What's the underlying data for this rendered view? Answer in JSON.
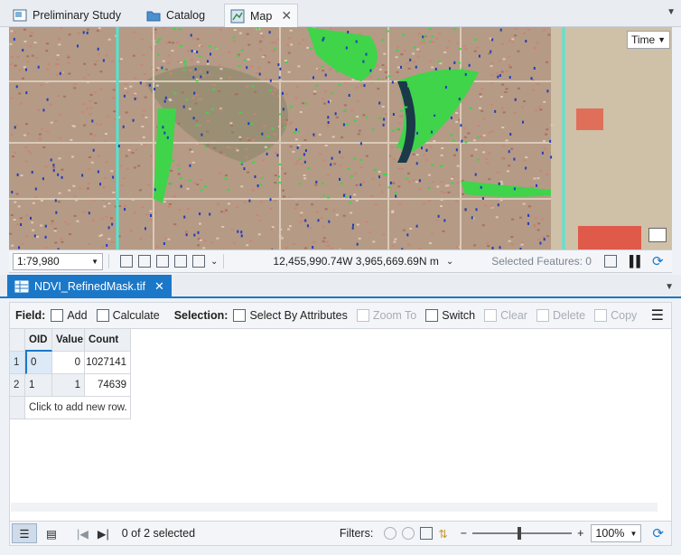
{
  "doc_tabs": [
    {
      "label": "Preliminary Study",
      "icon": "map-layout-icon"
    },
    {
      "label": "Catalog",
      "icon": "catalog-folder-icon"
    },
    {
      "label": "Map",
      "icon": "map-icon",
      "active": true
    }
  ],
  "map": {
    "time_button": "Time",
    "overlay_colors": {
      "vegetation": "#3fd44a",
      "water": "#1f3fb8",
      "line": "#4de8d4",
      "terrain": "#b59a86"
    }
  },
  "map_status": {
    "scale": "1:79,980",
    "coordinates": "12,455,990.74W 3,965,669.69N m",
    "selected_features": "Selected Features: 0"
  },
  "table_view": {
    "tab_label": "NDVI_RefinedMask.tif"
  },
  "toolbar": {
    "field_label": "Field:",
    "add": "Add",
    "calculate": "Calculate",
    "selection_label": "Selection:",
    "select_by_attributes": "Select By Attributes",
    "zoom_to": "Zoom To",
    "switch": "Switch",
    "clear": "Clear",
    "delete": "Delete",
    "copy": "Copy"
  },
  "table": {
    "columns": [
      "OID",
      "Value",
      "Count"
    ],
    "rows": [
      {
        "rownum": "1",
        "oid": "0",
        "value": "0",
        "count": "1027141"
      },
      {
        "rownum": "2",
        "oid": "1",
        "value": "1",
        "count": "74639"
      }
    ],
    "add_row_text": "Click to add new row."
  },
  "bottom_bar": {
    "selection_count": "0 of 2 selected",
    "filters_label": "Filters:",
    "zoom": "100%"
  }
}
